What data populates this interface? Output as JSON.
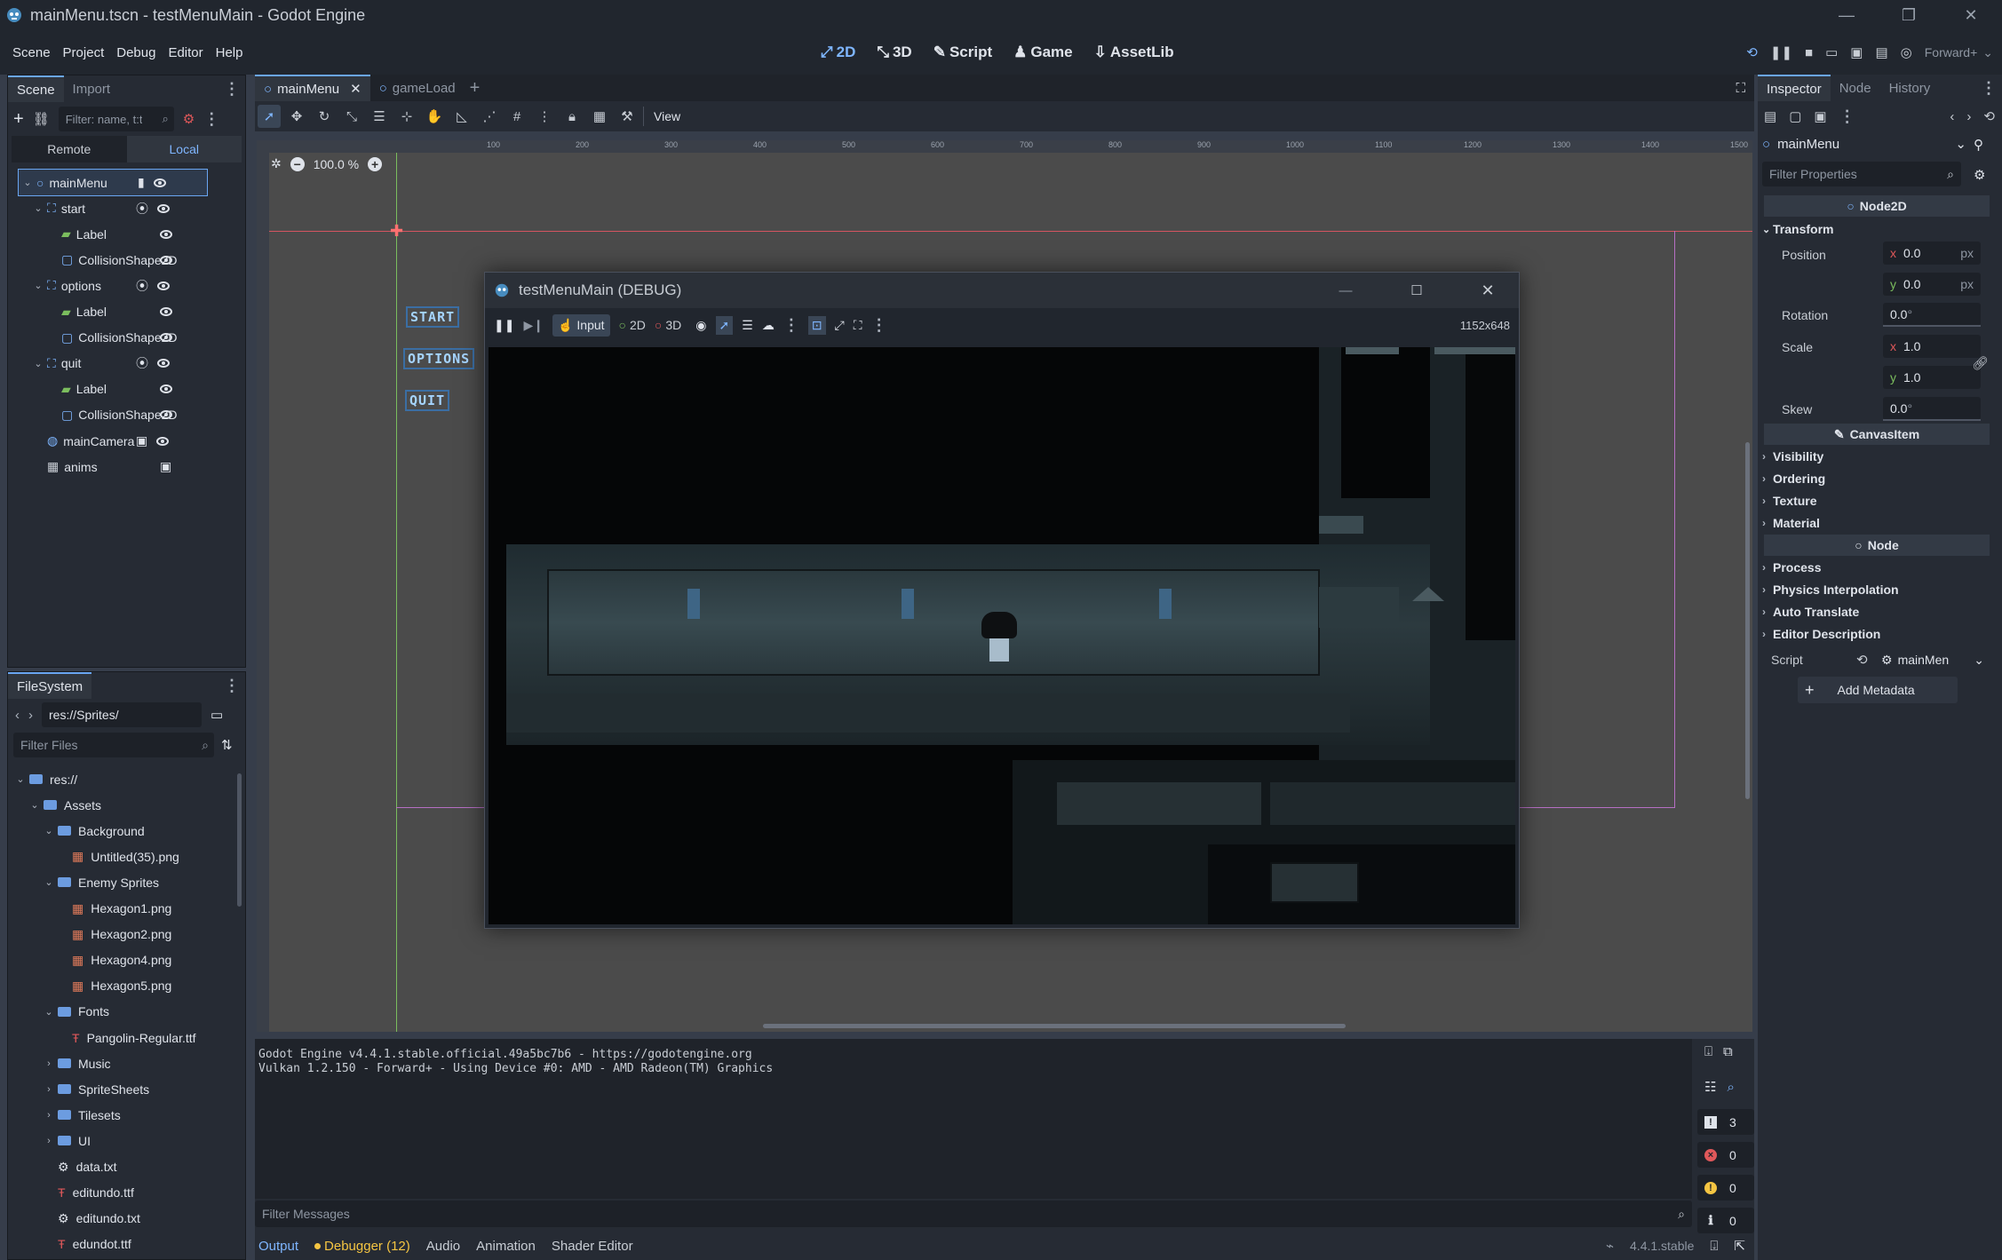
{
  "window": {
    "title": "mainMenu.tscn - testMenuMain - Godot Engine",
    "controls": [
      "—",
      "❐",
      "✕"
    ]
  },
  "menu": [
    "Scene",
    "Project",
    "Debug",
    "Editor",
    "Help"
  ],
  "main_screens": [
    {
      "label": "2D",
      "icon": "2d-icon",
      "active": true
    },
    {
      "label": "3D",
      "icon": "3d-icon"
    },
    {
      "label": "Script",
      "icon": "script-icon"
    },
    {
      "label": "Game",
      "icon": "game-icon"
    },
    {
      "label": "AssetLib",
      "icon": "assetlib-icon"
    }
  ],
  "renderer": "Forward+",
  "scene_dock": {
    "tabs": [
      "Scene",
      "Import"
    ],
    "filter_placeholder": "Filter: name, t:t",
    "remote_local": [
      "Remote",
      "Local"
    ],
    "nodes": [
      {
        "name": "mainMenu",
        "depth": 0,
        "icon": "node2d-icon"
      },
      {
        "name": "start",
        "depth": 1,
        "icon": "area2d-icon"
      },
      {
        "name": "Label",
        "depth": 2,
        "icon": "label-icon"
      },
      {
        "name": "CollisionShape2D",
        "depth": 2,
        "icon": "collision-shape-icon"
      },
      {
        "name": "options",
        "depth": 1,
        "icon": "area2d-icon"
      },
      {
        "name": "Label",
        "depth": 2,
        "icon": "label-icon"
      },
      {
        "name": "CollisionShape2D",
        "depth": 2,
        "icon": "collision-shape-icon"
      },
      {
        "name": "quit",
        "depth": 1,
        "icon": "area2d-icon"
      },
      {
        "name": "Label",
        "depth": 2,
        "icon": "label-icon"
      },
      {
        "name": "CollisionShape2D",
        "depth": 2,
        "icon": "collision-shape-icon"
      },
      {
        "name": "mainCamera",
        "depth": 1,
        "icon": "camera-icon"
      },
      {
        "name": "anims",
        "depth": 1,
        "icon": "animation-player-icon"
      }
    ]
  },
  "filesystem": {
    "title": "FileSystem",
    "path": "res://Sprites/",
    "filter_placeholder": "Filter Files",
    "items": [
      {
        "name": "res://",
        "depth": 0,
        "type": "folder",
        "open": true
      },
      {
        "name": "Assets",
        "depth": 1,
        "type": "folder",
        "open": true
      },
      {
        "name": "Background",
        "depth": 2,
        "type": "folder",
        "open": true
      },
      {
        "name": "Untitled(35).png",
        "depth": 3,
        "type": "image"
      },
      {
        "name": "Enemy Sprites",
        "depth": 2,
        "type": "folder",
        "open": true
      },
      {
        "name": "Hexagon1.png",
        "depth": 3,
        "type": "image"
      },
      {
        "name": "Hexagon2.png",
        "depth": 3,
        "type": "image"
      },
      {
        "name": "Hexagon4.png",
        "depth": 3,
        "type": "image"
      },
      {
        "name": "Hexagon5.png",
        "depth": 3,
        "type": "image"
      },
      {
        "name": "Fonts",
        "depth": 2,
        "type": "folder",
        "open": true
      },
      {
        "name": "Pangolin-Regular.ttf",
        "depth": 3,
        "type": "font"
      },
      {
        "name": "Music",
        "depth": 2,
        "type": "folder"
      },
      {
        "name": "SpriteSheets",
        "depth": 2,
        "type": "folder"
      },
      {
        "name": "Tilesets",
        "depth": 2,
        "type": "folder"
      },
      {
        "name": "UI",
        "depth": 2,
        "type": "folder"
      },
      {
        "name": "data.txt",
        "depth": 2,
        "type": "text"
      },
      {
        "name": "editundo.ttf",
        "depth": 2,
        "type": "font"
      },
      {
        "name": "editundo.txt",
        "depth": 2,
        "type": "text"
      },
      {
        "name": "edundot.ttf",
        "depth": 2,
        "type": "font"
      }
    ]
  },
  "editor_tabs": [
    "mainMenu",
    "gameLoad"
  ],
  "viewport": {
    "zoom": "100.0 %",
    "view_menu": "View",
    "ruler_labels": [
      "100",
      "200",
      "300",
      "400",
      "500",
      "600",
      "700",
      "800",
      "900",
      "1000",
      "1100",
      "1200",
      "1300",
      "1400",
      "1500"
    ],
    "menu_buttons": [
      "START",
      "OPTIONS",
      "QUIT"
    ]
  },
  "debug_window": {
    "title": "testMenuMain (DEBUG)",
    "input_label": "Input",
    "mode_2d": "2D",
    "mode_3d": "3D",
    "resolution": "1152x648"
  },
  "inspector": {
    "tabs": [
      "Inspector",
      "Node",
      "History"
    ],
    "object": "mainMenu",
    "filter_placeholder": "Filter Properties",
    "class_header": "Node2D",
    "transform": "Transform",
    "position_label": "Position",
    "position_x": "0.0",
    "position_y": "0.0",
    "unit_px": "px",
    "rotation_label": "Rotation",
    "rotation": "0.0",
    "scale_label": "Scale",
    "scale_x": "1.0",
    "scale_y": "1.0",
    "skew_label": "Skew",
    "skew": "0.0",
    "deg": "°",
    "axis_x": "x",
    "axis_y": "y",
    "canvas_item": "CanvasItem",
    "canvas_sections": [
      "Visibility",
      "Ordering",
      "Texture",
      "Material"
    ],
    "node_header": "Node",
    "node_sections": [
      "Process",
      "Physics Interpolation",
      "Auto Translate",
      "Editor Description"
    ],
    "script_label": "Script",
    "script_value": "mainMen",
    "add_metadata": "Add Metadata"
  },
  "output": {
    "lines": [
      "Godot Engine v4.4.1.stable.official.49a5bc7b6 - https://godotengine.org",
      "Vulkan 1.2.150 - Forward+ - Using Device #0: AMD - AMD Radeon(TM) Graphics"
    ],
    "filter_placeholder": "Filter Messages",
    "counts": {
      "messages": "3",
      "errors": "0",
      "warnings": "0",
      "info": "0"
    }
  },
  "bottom_tabs": [
    "Output",
    "Debugger (12)",
    "Audio",
    "Animation",
    "Shader Editor"
  ],
  "version": "4.4.1.stable",
  "colors": {
    "accent": "#6aa6f2",
    "warning": "#f5c542",
    "error": "#e0585a",
    "editor_bg": "#262b34"
  }
}
